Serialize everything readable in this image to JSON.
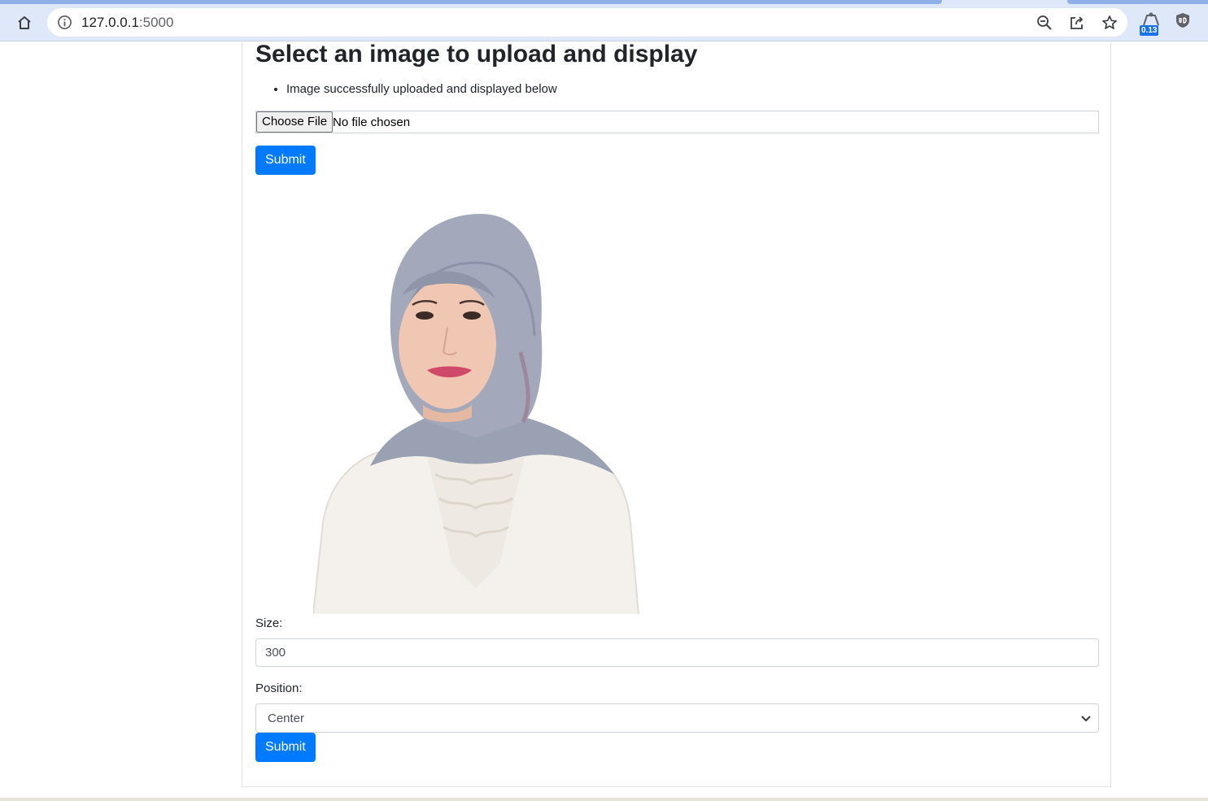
{
  "browser": {
    "url_host": "127.0.0.1",
    "url_port": ":5000",
    "extension_badge": "0.13"
  },
  "page": {
    "heading": "Select an image to upload and display",
    "flash_message": "Image successfully uploaded and displayed below",
    "file_input": {
      "button_label": "Choose File",
      "status": "No file chosen"
    },
    "upload_submit_label": "Submit",
    "size_label": "Size:",
    "size_value": "300",
    "position_label": "Position:",
    "position_selected": "Center",
    "settings_submit_label": "Submit"
  },
  "colors": {
    "primary_button": "#007bff",
    "chrome_bar": "#dee8f8",
    "badge": "#1a73e8"
  },
  "icons": [
    "home-icon",
    "info-icon",
    "zoom-out-icon",
    "share-icon",
    "star-icon",
    "extension-icon",
    "shield-extension-icon",
    "chevron-down-icon"
  ]
}
